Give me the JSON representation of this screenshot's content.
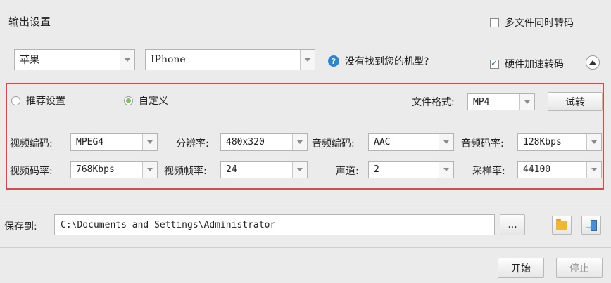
{
  "output_settings": {
    "title": "输出设置",
    "multi_file_label": "多文件同时转码",
    "multi_file_checked": false
  },
  "device": {
    "brand": "苹果",
    "model": "IPhone",
    "help_text": "没有找到您的机型?",
    "hw_accel_label": "硬件加速转码",
    "hw_accel_checked": true
  },
  "mode": {
    "recommended_label": "推荐设置",
    "custom_label": "自定义",
    "selected": "custom"
  },
  "file_format": {
    "label": "文件格式:",
    "value": "MP4"
  },
  "try_button": "试转",
  "params": {
    "video_codec": {
      "label": "视频编码:",
      "value": "MPEG4"
    },
    "resolution": {
      "label": "分辨率:",
      "value": "480x320"
    },
    "audio_codec": {
      "label": "音频编码:",
      "value": "AAC"
    },
    "audio_bitrate": {
      "label": "音频码率:",
      "value": "128Kbps"
    },
    "video_bitrate": {
      "label": "视频码率:",
      "value": "768Kbps"
    },
    "frame_rate": {
      "label": "视频帧率:",
      "value": "24"
    },
    "channels": {
      "label": "声道:",
      "value": "2"
    },
    "sample_rate": {
      "label": "采样率:",
      "value": "44100"
    }
  },
  "save": {
    "label": "保存到:",
    "path": "C:\\Documents and Settings\\Administrator",
    "browse_label": "..."
  },
  "actions": {
    "start": "开始",
    "stop": "停止"
  },
  "icons": {
    "help": "question-circle-icon",
    "collapse": "chevron-up-circle-icon",
    "folder": "folder-icon",
    "exit": "exit-icon"
  },
  "colors": {
    "highlight_border": "#d9484d",
    "radio_selected": "#7cc06b",
    "help": "#2f84d0"
  }
}
